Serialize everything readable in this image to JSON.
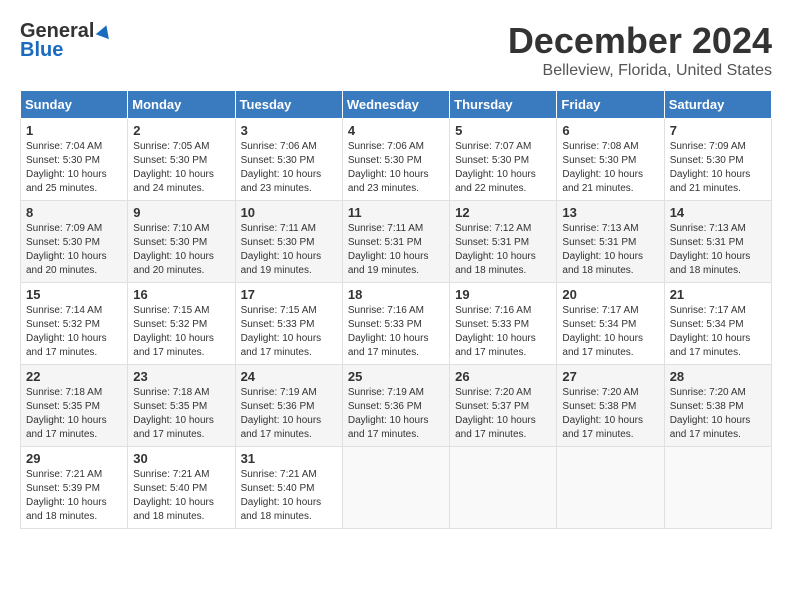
{
  "logo": {
    "general": "General",
    "blue": "Blue"
  },
  "title": "December 2024",
  "location": "Belleview, Florida, United States",
  "days_of_week": [
    "Sunday",
    "Monday",
    "Tuesday",
    "Wednesday",
    "Thursday",
    "Friday",
    "Saturday"
  ],
  "weeks": [
    [
      {
        "day": "1",
        "sunrise": "7:04 AM",
        "sunset": "5:30 PM",
        "daylight": "10 hours and 25 minutes."
      },
      {
        "day": "2",
        "sunrise": "7:05 AM",
        "sunset": "5:30 PM",
        "daylight": "10 hours and 24 minutes."
      },
      {
        "day": "3",
        "sunrise": "7:06 AM",
        "sunset": "5:30 PM",
        "daylight": "10 hours and 23 minutes."
      },
      {
        "day": "4",
        "sunrise": "7:06 AM",
        "sunset": "5:30 PM",
        "daylight": "10 hours and 23 minutes."
      },
      {
        "day": "5",
        "sunrise": "7:07 AM",
        "sunset": "5:30 PM",
        "daylight": "10 hours and 22 minutes."
      },
      {
        "day": "6",
        "sunrise": "7:08 AM",
        "sunset": "5:30 PM",
        "daylight": "10 hours and 21 minutes."
      },
      {
        "day": "7",
        "sunrise": "7:09 AM",
        "sunset": "5:30 PM",
        "daylight": "10 hours and 21 minutes."
      }
    ],
    [
      {
        "day": "8",
        "sunrise": "7:09 AM",
        "sunset": "5:30 PM",
        "daylight": "10 hours and 20 minutes."
      },
      {
        "day": "9",
        "sunrise": "7:10 AM",
        "sunset": "5:30 PM",
        "daylight": "10 hours and 20 minutes."
      },
      {
        "day": "10",
        "sunrise": "7:11 AM",
        "sunset": "5:30 PM",
        "daylight": "10 hours and 19 minutes."
      },
      {
        "day": "11",
        "sunrise": "7:11 AM",
        "sunset": "5:31 PM",
        "daylight": "10 hours and 19 minutes."
      },
      {
        "day": "12",
        "sunrise": "7:12 AM",
        "sunset": "5:31 PM",
        "daylight": "10 hours and 18 minutes."
      },
      {
        "day": "13",
        "sunrise": "7:13 AM",
        "sunset": "5:31 PM",
        "daylight": "10 hours and 18 minutes."
      },
      {
        "day": "14",
        "sunrise": "7:13 AM",
        "sunset": "5:31 PM",
        "daylight": "10 hours and 18 minutes."
      }
    ],
    [
      {
        "day": "15",
        "sunrise": "7:14 AM",
        "sunset": "5:32 PM",
        "daylight": "10 hours and 17 minutes."
      },
      {
        "day": "16",
        "sunrise": "7:15 AM",
        "sunset": "5:32 PM",
        "daylight": "10 hours and 17 minutes."
      },
      {
        "day": "17",
        "sunrise": "7:15 AM",
        "sunset": "5:33 PM",
        "daylight": "10 hours and 17 minutes."
      },
      {
        "day": "18",
        "sunrise": "7:16 AM",
        "sunset": "5:33 PM",
        "daylight": "10 hours and 17 minutes."
      },
      {
        "day": "19",
        "sunrise": "7:16 AM",
        "sunset": "5:33 PM",
        "daylight": "10 hours and 17 minutes."
      },
      {
        "day": "20",
        "sunrise": "7:17 AM",
        "sunset": "5:34 PM",
        "daylight": "10 hours and 17 minutes."
      },
      {
        "day": "21",
        "sunrise": "7:17 AM",
        "sunset": "5:34 PM",
        "daylight": "10 hours and 17 minutes."
      }
    ],
    [
      {
        "day": "22",
        "sunrise": "7:18 AM",
        "sunset": "5:35 PM",
        "daylight": "10 hours and 17 minutes."
      },
      {
        "day": "23",
        "sunrise": "7:18 AM",
        "sunset": "5:35 PM",
        "daylight": "10 hours and 17 minutes."
      },
      {
        "day": "24",
        "sunrise": "7:19 AM",
        "sunset": "5:36 PM",
        "daylight": "10 hours and 17 minutes."
      },
      {
        "day": "25",
        "sunrise": "7:19 AM",
        "sunset": "5:36 PM",
        "daylight": "10 hours and 17 minutes."
      },
      {
        "day": "26",
        "sunrise": "7:20 AM",
        "sunset": "5:37 PM",
        "daylight": "10 hours and 17 minutes."
      },
      {
        "day": "27",
        "sunrise": "7:20 AM",
        "sunset": "5:38 PM",
        "daylight": "10 hours and 17 minutes."
      },
      {
        "day": "28",
        "sunrise": "7:20 AM",
        "sunset": "5:38 PM",
        "daylight": "10 hours and 17 minutes."
      }
    ],
    [
      {
        "day": "29",
        "sunrise": "7:21 AM",
        "sunset": "5:39 PM",
        "daylight": "10 hours and 18 minutes."
      },
      {
        "day": "30",
        "sunrise": "7:21 AM",
        "sunset": "5:40 PM",
        "daylight": "10 hours and 18 minutes."
      },
      {
        "day": "31",
        "sunrise": "7:21 AM",
        "sunset": "5:40 PM",
        "daylight": "10 hours and 18 minutes."
      },
      null,
      null,
      null,
      null
    ]
  ],
  "labels": {
    "sunrise_prefix": "Sunrise: ",
    "sunset_prefix": "Sunset: ",
    "daylight_prefix": "Daylight: "
  }
}
